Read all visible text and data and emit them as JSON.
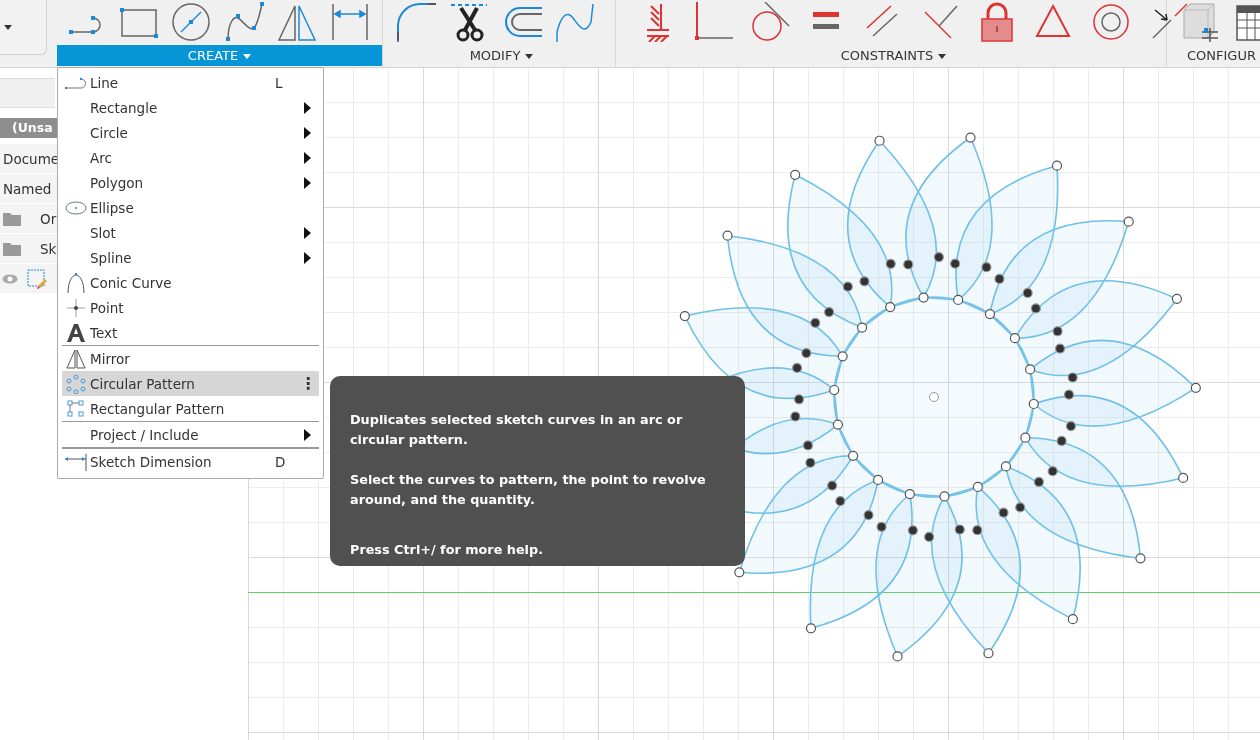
{
  "toolbar": {
    "groups": [
      {
        "label": "CREATE",
        "selected": true,
        "caret": true
      },
      {
        "label": "MODIFY",
        "selected": false,
        "caret": true
      },
      {
        "label": "CONSTRAINTS",
        "selected": false,
        "caret": true
      },
      {
        "label": "CONFIGUR",
        "selected": false
      }
    ]
  },
  "browser": {
    "header": "(Unsa",
    "items": [
      {
        "label": "Docume",
        "kind": "plain"
      },
      {
        "label": "Named",
        "kind": "plain"
      },
      {
        "label": "Or",
        "kind": "folder"
      },
      {
        "label": "Sk",
        "kind": "folder"
      }
    ]
  },
  "create_menu": {
    "items": [
      {
        "label": "Line",
        "shortcut": "L",
        "submenu": false,
        "highlighted": false,
        "divider_before": false
      },
      {
        "label": "Rectangle",
        "submenu": true,
        "highlighted": false,
        "divider_before": false
      },
      {
        "label": "Circle",
        "submenu": true,
        "highlighted": false,
        "divider_before": false
      },
      {
        "label": "Arc",
        "submenu": true,
        "highlighted": false,
        "divider_before": false
      },
      {
        "label": "Polygon",
        "submenu": true,
        "highlighted": false,
        "divider_before": false
      },
      {
        "label": "Ellipse",
        "submenu": false,
        "highlighted": false,
        "divider_before": false
      },
      {
        "label": "Slot",
        "submenu": true,
        "highlighted": false,
        "divider_before": false
      },
      {
        "label": "Spline",
        "submenu": true,
        "highlighted": false,
        "divider_before": false
      },
      {
        "label": "Conic Curve",
        "submenu": false,
        "highlighted": false,
        "divider_before": false
      },
      {
        "label": "Point",
        "submenu": false,
        "highlighted": false,
        "divider_before": false
      },
      {
        "label": "Text",
        "submenu": false,
        "highlighted": false,
        "divider_before": false
      },
      {
        "label": "Mirror",
        "submenu": false,
        "highlighted": false,
        "divider_before": true
      },
      {
        "label": "Circular Pattern",
        "submenu": false,
        "highlighted": true,
        "divider_before": false,
        "more": "⋮"
      },
      {
        "label": "Rectangular Pattern",
        "submenu": false,
        "highlighted": false,
        "divider_before": false
      },
      {
        "label": "Project / Include",
        "submenu": true,
        "highlighted": false,
        "divider_before": true
      },
      {
        "label": "Sketch Dimension",
        "shortcut": "D",
        "submenu": false,
        "highlighted": false,
        "divider_before": true
      }
    ]
  },
  "tooltip": {
    "paragraphs": [
      "Duplicates selected sketch curves in an arc or circular pattern.",
      "Select the curves to pattern, the point to revolve around, and the quantity.",
      "Press Ctrl+/ for more help."
    ]
  }
}
